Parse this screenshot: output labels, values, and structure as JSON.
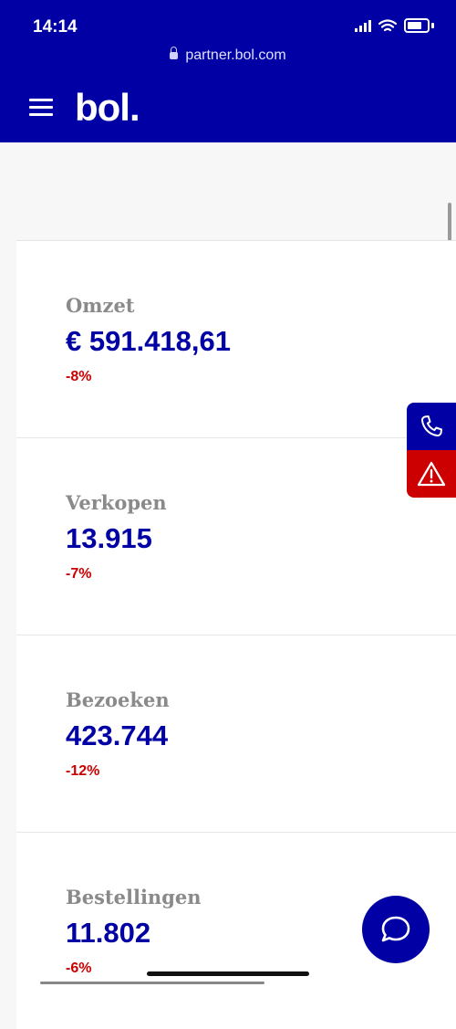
{
  "status_bar": {
    "time": "14:14"
  },
  "browser": {
    "url": "partner.bol.com"
  },
  "header": {
    "logo": "bol."
  },
  "metrics": [
    {
      "label": "Omzet",
      "value": "€ 591.418,61",
      "change": "-8%"
    },
    {
      "label": "Verkopen",
      "value": "13.915",
      "change": "-7%"
    },
    {
      "label": "Bezoeken",
      "value": "423.744",
      "change": "-12%"
    },
    {
      "label": "Bestellingen",
      "value": "11.802",
      "change": "-6%"
    }
  ],
  "colors": {
    "brand": "#0000a4",
    "negative": "#cc0000",
    "label": "#8a8a8a"
  },
  "icons": {
    "menu": "hamburger-icon",
    "phone": "phone-icon",
    "alert": "warning-icon",
    "chat": "chat-bubble-icon"
  }
}
